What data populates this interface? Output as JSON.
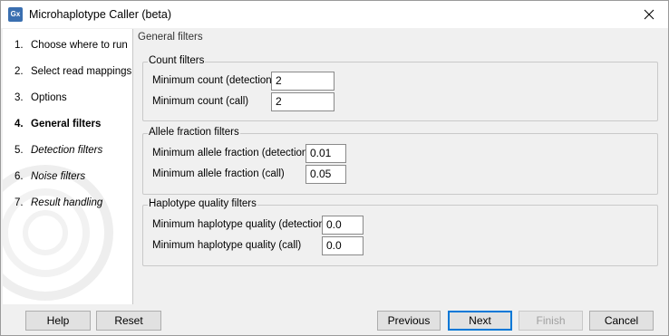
{
  "window": {
    "title": "Microhaplotype Caller (beta)",
    "icon_label": "Gx"
  },
  "steps": [
    {
      "num": "1.",
      "label": "Choose where to run",
      "state": "normal"
    },
    {
      "num": "2.",
      "label": "Select read mappings",
      "state": "normal"
    },
    {
      "num": "3.",
      "label": "Options",
      "state": "normal"
    },
    {
      "num": "4.",
      "label": "General filters",
      "state": "active"
    },
    {
      "num": "5.",
      "label": "Detection filters",
      "state": "italic"
    },
    {
      "num": "6.",
      "label": "Noise filters",
      "state": "italic"
    },
    {
      "num": "7.",
      "label": "Result handling",
      "state": "italic"
    }
  ],
  "content": {
    "heading": "General filters",
    "count_filters": {
      "legend": "Count filters",
      "detection_label": "Minimum count (detection)",
      "detection_value": "2",
      "call_label": "Minimum count (call)",
      "call_value": "2"
    },
    "allele_filters": {
      "legend": "Allele fraction filters",
      "detection_label": "Minimum allele fraction (detection)",
      "detection_value": "0.01",
      "call_label": "Minimum allele fraction (call)",
      "call_value": "0.05"
    },
    "haplotype_filters": {
      "legend": "Haplotype quality filters",
      "detection_label": "Minimum haplotype quality (detection)",
      "detection_value": "0.0",
      "call_label": "Minimum haplotype quality (call)",
      "call_value": "0.0"
    }
  },
  "buttons": {
    "help": "Help",
    "reset": "Reset",
    "previous": "Previous",
    "next": "Next",
    "finish": "Finish",
    "cancel": "Cancel"
  }
}
